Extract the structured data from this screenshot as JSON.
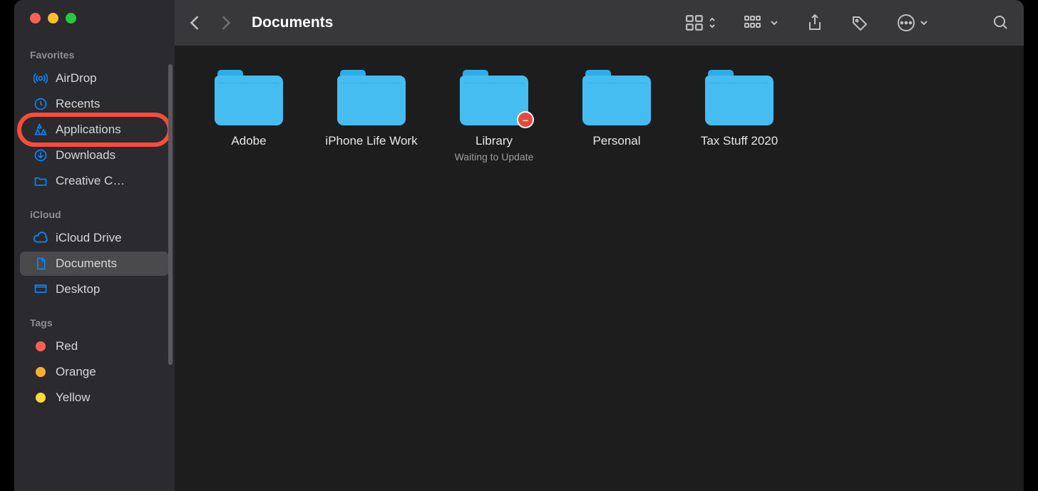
{
  "window_title": "Documents",
  "traffic_lights": [
    "close",
    "minimize",
    "maximize"
  ],
  "toolbar": {
    "back_enabled": true,
    "forward_enabled": false,
    "icons": [
      "view-icons",
      "view-sort",
      "view-groups",
      "share",
      "tags",
      "more",
      "search"
    ]
  },
  "sidebar": {
    "sections": [
      {
        "title": "Favorites",
        "items": [
          {
            "icon": "airdrop-icon",
            "label": "AirDrop"
          },
          {
            "icon": "clock-icon",
            "label": "Recents"
          },
          {
            "icon": "apps-icon",
            "label": "Applications",
            "highlighted": true
          },
          {
            "icon": "download-icon",
            "label": "Downloads"
          },
          {
            "icon": "folder-icon",
            "label": "Creative C…"
          }
        ]
      },
      {
        "title": "iCloud",
        "items": [
          {
            "icon": "cloud-icon",
            "label": "iCloud Drive"
          },
          {
            "icon": "document-icon",
            "label": "Documents",
            "selected": true
          },
          {
            "icon": "desktop-icon",
            "label": "Desktop"
          }
        ]
      },
      {
        "title": "Tags",
        "items": [
          {
            "icon": "tag-dot",
            "color": "#fe5f57",
            "label": "Red"
          },
          {
            "icon": "tag-dot",
            "color": "#feae2f",
            "label": "Orange"
          },
          {
            "icon": "tag-dot",
            "color": "#fedb3a",
            "label": "Yellow"
          }
        ]
      }
    ]
  },
  "folders": [
    {
      "name": "Adobe"
    },
    {
      "name": "iPhone Life Work"
    },
    {
      "name": "Library",
      "subtitle": "Waiting to Update",
      "no_entry": true
    },
    {
      "name": "Personal"
    },
    {
      "name": "Tax Stuff 2020"
    }
  ]
}
